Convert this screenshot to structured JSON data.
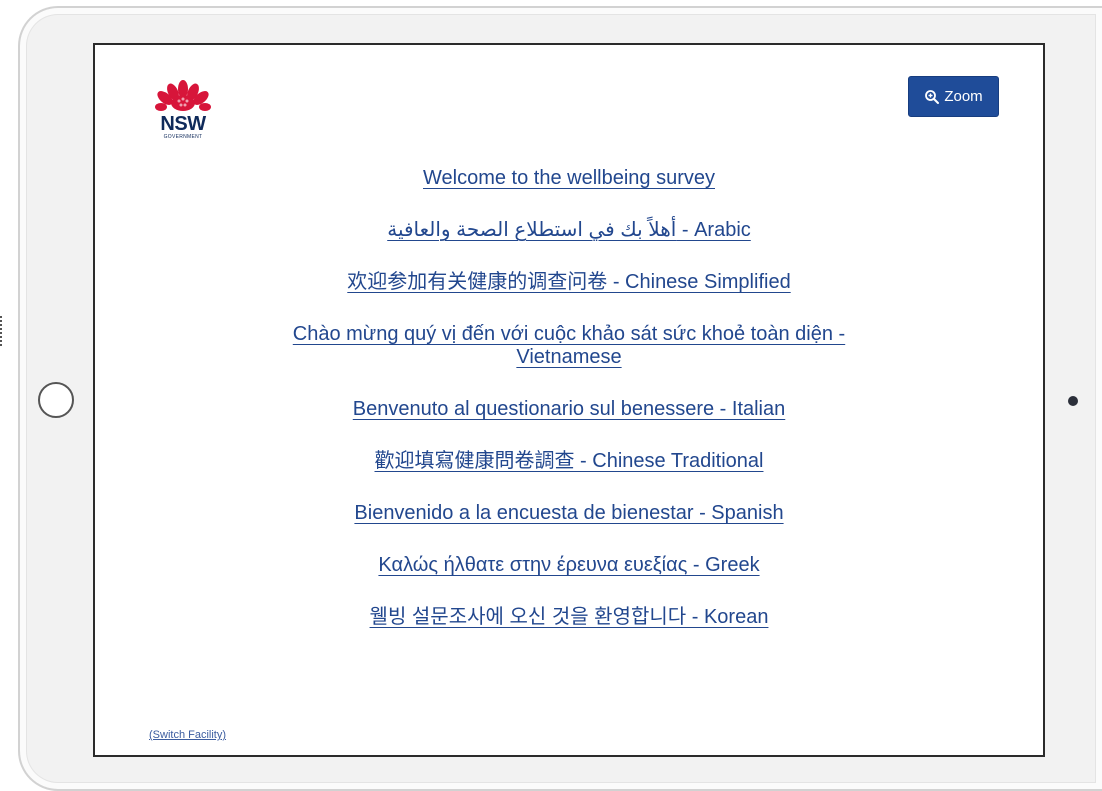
{
  "header": {
    "logo_text": "NSW",
    "logo_subtext": "GOVERNMENT",
    "zoom_label": "Zoom"
  },
  "links": [
    {
      "label": "Welcome to the wellbeing survey"
    },
    {
      "label": "أهلاً بك في استطلاع الصحة والعافية - Arabic"
    },
    {
      "label": "欢迎参加有关健康的调查问卷 - Chinese Simplified"
    },
    {
      "label": "Chào mừng quý vị đến với cuộc khảo sát sức khoẻ toàn diện - Vietnamese"
    },
    {
      "label": "Benvenuto al questionario sul benessere - Italian"
    },
    {
      "label": "歡迎填寫健康問卷調查 - Chinese Traditional"
    },
    {
      "label": "Bienvenido a la encuesta de bienestar - Spanish"
    },
    {
      "label": "Καλώς ήλθατε στην έρευνα ευεξίας - Greek"
    },
    {
      "label": "웰빙 설문조사에 오신 것을 환영합니다 - Korean"
    }
  ],
  "footer": {
    "switch_label": "(Switch Facility)"
  },
  "colors": {
    "link": "#22478e",
    "button": "#1f4c99",
    "logo_red": "#d7153a"
  },
  "icons": {
    "logo": "nsw-waratah-logo",
    "zoom": "zoom-in-icon",
    "home": "home-button"
  }
}
